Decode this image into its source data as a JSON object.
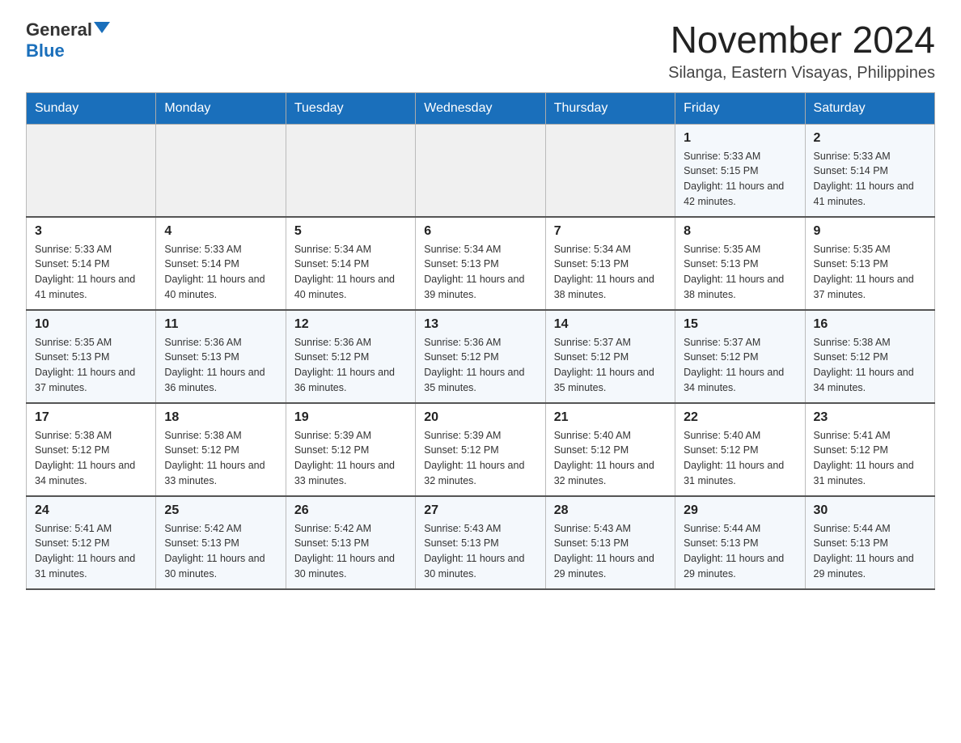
{
  "logo": {
    "general": "General",
    "blue": "Blue"
  },
  "title": "November 2024",
  "subtitle": "Silanga, Eastern Visayas, Philippines",
  "headers": [
    "Sunday",
    "Monday",
    "Tuesday",
    "Wednesday",
    "Thursday",
    "Friday",
    "Saturday"
  ],
  "weeks": [
    [
      {
        "day": "",
        "info": ""
      },
      {
        "day": "",
        "info": ""
      },
      {
        "day": "",
        "info": ""
      },
      {
        "day": "",
        "info": ""
      },
      {
        "day": "",
        "info": ""
      },
      {
        "day": "1",
        "info": "Sunrise: 5:33 AM\nSunset: 5:15 PM\nDaylight: 11 hours and 42 minutes."
      },
      {
        "day": "2",
        "info": "Sunrise: 5:33 AM\nSunset: 5:14 PM\nDaylight: 11 hours and 41 minutes."
      }
    ],
    [
      {
        "day": "3",
        "info": "Sunrise: 5:33 AM\nSunset: 5:14 PM\nDaylight: 11 hours and 41 minutes."
      },
      {
        "day": "4",
        "info": "Sunrise: 5:33 AM\nSunset: 5:14 PM\nDaylight: 11 hours and 40 minutes."
      },
      {
        "day": "5",
        "info": "Sunrise: 5:34 AM\nSunset: 5:14 PM\nDaylight: 11 hours and 40 minutes."
      },
      {
        "day": "6",
        "info": "Sunrise: 5:34 AM\nSunset: 5:13 PM\nDaylight: 11 hours and 39 minutes."
      },
      {
        "day": "7",
        "info": "Sunrise: 5:34 AM\nSunset: 5:13 PM\nDaylight: 11 hours and 38 minutes."
      },
      {
        "day": "8",
        "info": "Sunrise: 5:35 AM\nSunset: 5:13 PM\nDaylight: 11 hours and 38 minutes."
      },
      {
        "day": "9",
        "info": "Sunrise: 5:35 AM\nSunset: 5:13 PM\nDaylight: 11 hours and 37 minutes."
      }
    ],
    [
      {
        "day": "10",
        "info": "Sunrise: 5:35 AM\nSunset: 5:13 PM\nDaylight: 11 hours and 37 minutes."
      },
      {
        "day": "11",
        "info": "Sunrise: 5:36 AM\nSunset: 5:13 PM\nDaylight: 11 hours and 36 minutes."
      },
      {
        "day": "12",
        "info": "Sunrise: 5:36 AM\nSunset: 5:12 PM\nDaylight: 11 hours and 36 minutes."
      },
      {
        "day": "13",
        "info": "Sunrise: 5:36 AM\nSunset: 5:12 PM\nDaylight: 11 hours and 35 minutes."
      },
      {
        "day": "14",
        "info": "Sunrise: 5:37 AM\nSunset: 5:12 PM\nDaylight: 11 hours and 35 minutes."
      },
      {
        "day": "15",
        "info": "Sunrise: 5:37 AM\nSunset: 5:12 PM\nDaylight: 11 hours and 34 minutes."
      },
      {
        "day": "16",
        "info": "Sunrise: 5:38 AM\nSunset: 5:12 PM\nDaylight: 11 hours and 34 minutes."
      }
    ],
    [
      {
        "day": "17",
        "info": "Sunrise: 5:38 AM\nSunset: 5:12 PM\nDaylight: 11 hours and 34 minutes."
      },
      {
        "day": "18",
        "info": "Sunrise: 5:38 AM\nSunset: 5:12 PM\nDaylight: 11 hours and 33 minutes."
      },
      {
        "day": "19",
        "info": "Sunrise: 5:39 AM\nSunset: 5:12 PM\nDaylight: 11 hours and 33 minutes."
      },
      {
        "day": "20",
        "info": "Sunrise: 5:39 AM\nSunset: 5:12 PM\nDaylight: 11 hours and 32 minutes."
      },
      {
        "day": "21",
        "info": "Sunrise: 5:40 AM\nSunset: 5:12 PM\nDaylight: 11 hours and 32 minutes."
      },
      {
        "day": "22",
        "info": "Sunrise: 5:40 AM\nSunset: 5:12 PM\nDaylight: 11 hours and 31 minutes."
      },
      {
        "day": "23",
        "info": "Sunrise: 5:41 AM\nSunset: 5:12 PM\nDaylight: 11 hours and 31 minutes."
      }
    ],
    [
      {
        "day": "24",
        "info": "Sunrise: 5:41 AM\nSunset: 5:12 PM\nDaylight: 11 hours and 31 minutes."
      },
      {
        "day": "25",
        "info": "Sunrise: 5:42 AM\nSunset: 5:13 PM\nDaylight: 11 hours and 30 minutes."
      },
      {
        "day": "26",
        "info": "Sunrise: 5:42 AM\nSunset: 5:13 PM\nDaylight: 11 hours and 30 minutes."
      },
      {
        "day": "27",
        "info": "Sunrise: 5:43 AM\nSunset: 5:13 PM\nDaylight: 11 hours and 30 minutes."
      },
      {
        "day": "28",
        "info": "Sunrise: 5:43 AM\nSunset: 5:13 PM\nDaylight: 11 hours and 29 minutes."
      },
      {
        "day": "29",
        "info": "Sunrise: 5:44 AM\nSunset: 5:13 PM\nDaylight: 11 hours and 29 minutes."
      },
      {
        "day": "30",
        "info": "Sunrise: 5:44 AM\nSunset: 5:13 PM\nDaylight: 11 hours and 29 minutes."
      }
    ]
  ]
}
